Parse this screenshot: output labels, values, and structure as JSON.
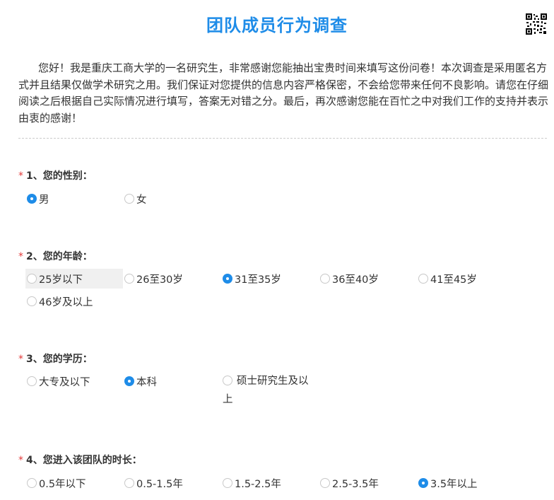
{
  "survey": {
    "title": "团队成员行为调查",
    "intro": "您好！我是重庆工商大学的一名研究生，非常感谢您能抽出宝贵时间来填写这份问卷！本次调查是采用匿名方式并且结果仅做学术研究之用。我们保证对您提供的信息内容严格保密，不会给您带来任何不良影响。请您在仔细阅读之后根据自己实际情况进行填写，答案无对错之分。最后，再次感谢您能在百忙之中对我们工作的支持并表示由衷的感谢！"
  },
  "questions": [
    {
      "required_mark": "*",
      "title": "1、您的性别：",
      "options": [
        "男",
        "女"
      ],
      "selected": "男"
    },
    {
      "required_mark": "*",
      "title": "2、您的年龄：",
      "options": [
        "25岁以下",
        "26至30岁",
        "31至35岁",
        "36至40岁",
        "41至45岁",
        "46岁及以上"
      ],
      "selected": "31至35岁"
    },
    {
      "required_mark": "*",
      "title": "3、您的学历：",
      "options": [
        "大专及以下",
        "本科",
        "硕士研究生及以上"
      ],
      "selected": "本科"
    },
    {
      "required_mark": "*",
      "title": "4、您进入该团队的时长：",
      "options": [
        "0.5年以下",
        "0.5-1.5年",
        "1.5-2.5年",
        "2.5-3.5年",
        "3.5年以上"
      ],
      "selected": "3.5年以上"
    }
  ],
  "colors": {
    "accent": "#1e8ce8",
    "required": "#e33a3a",
    "hover_bg": "#f0f0f0"
  },
  "icons": {
    "qr": "qr-code-icon",
    "radio_on": "radio-checked-icon",
    "radio_off": "radio-unchecked-icon"
  }
}
